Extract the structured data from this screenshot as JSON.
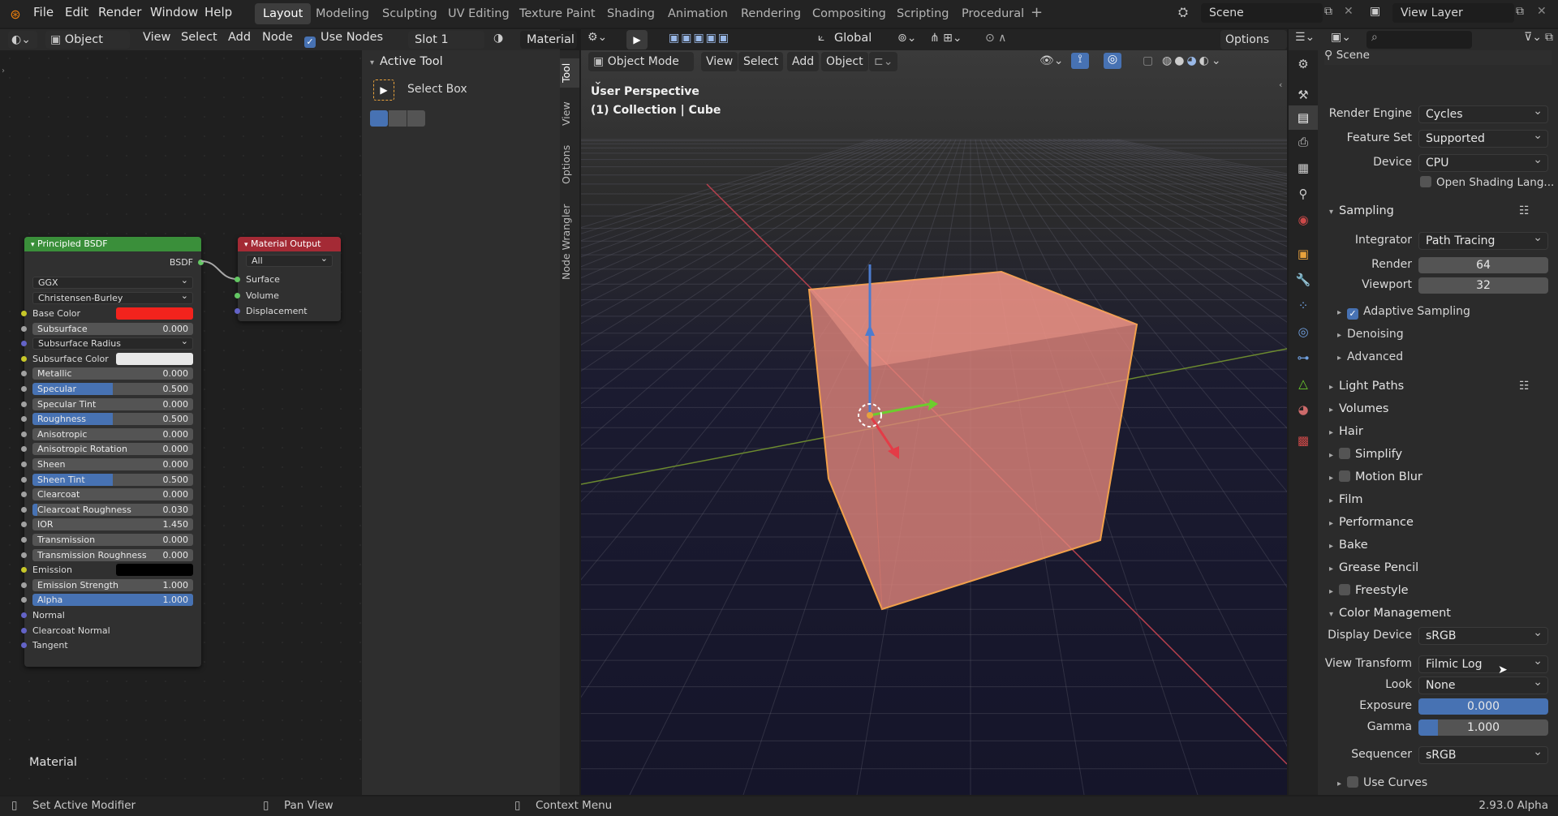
{
  "menu": {
    "file": "File",
    "edit": "Edit",
    "render": "Render",
    "window": "Window",
    "help": "Help"
  },
  "workspaces": [
    "Layout",
    "Modeling",
    "Sculpting",
    "UV Editing",
    "Texture Paint",
    "Shading",
    "Animation",
    "Rendering",
    "Compositing",
    "Scripting",
    "Procedural"
  ],
  "scene": {
    "label": "Scene",
    "view_layer": "View Layer"
  },
  "node_header": {
    "mode": "Object",
    "view": "View",
    "select": "Select",
    "add": "Add",
    "node": "Node",
    "use_nodes": "Use Nodes",
    "slot": "Slot 1",
    "material": "Material"
  },
  "principled": {
    "title": "Principled BSDF",
    "output": "BSDF",
    "distribution": "GGX",
    "subsurface_method": "Christensen-Burley",
    "inputs": [
      {
        "label": "Base Color",
        "type": "color",
        "color": "#f2231d",
        "sock": "sy"
      },
      {
        "label": "Subsurface",
        "value": "0.000",
        "fill": 0,
        "sock": "sg"
      },
      {
        "label": "Subsurface Radius",
        "type": "dd",
        "sock": "sb"
      },
      {
        "label": "Subsurface Color",
        "type": "color",
        "color": "#e8e8e8",
        "sock": "sy"
      },
      {
        "label": "Metallic",
        "value": "0.000",
        "fill": 0,
        "sock": "sg"
      },
      {
        "label": "Specular",
        "value": "0.500",
        "fill": 0.5,
        "sock": "sg"
      },
      {
        "label": "Specular Tint",
        "value": "0.000",
        "fill": 0,
        "sock": "sg"
      },
      {
        "label": "Roughness",
        "value": "0.500",
        "fill": 0.5,
        "sock": "sg"
      },
      {
        "label": "Anisotropic",
        "value": "0.000",
        "fill": 0,
        "sock": "sg"
      },
      {
        "label": "Anisotropic Rotation",
        "value": "0.000",
        "fill": 0,
        "sock": "sg"
      },
      {
        "label": "Sheen",
        "value": "0.000",
        "fill": 0,
        "sock": "sg"
      },
      {
        "label": "Sheen Tint",
        "value": "0.500",
        "fill": 0.5,
        "sock": "sg"
      },
      {
        "label": "Clearcoat",
        "value": "0.000",
        "fill": 0,
        "sock": "sg"
      },
      {
        "label": "Clearcoat Roughness",
        "value": "0.030",
        "fill": 0.03,
        "sock": "sg"
      },
      {
        "label": "IOR",
        "value": "1.450",
        "fill": 0,
        "sock": "sg"
      },
      {
        "label": "Transmission",
        "value": "0.000",
        "fill": 0,
        "sock": "sg"
      },
      {
        "label": "Transmission Roughness",
        "value": "0.000",
        "fill": 0,
        "sock": "sg"
      },
      {
        "label": "Emission",
        "type": "color",
        "color": "#000000",
        "sock": "sy"
      },
      {
        "label": "Emission Strength",
        "value": "1.000",
        "fill": 0,
        "sock": "sg"
      },
      {
        "label": "Alpha",
        "value": "1.000",
        "fill": 1,
        "sock": "sg"
      },
      {
        "label": "Normal",
        "type": "socket",
        "sock": "sb"
      },
      {
        "label": "Clearcoat Normal",
        "type": "socket",
        "sock": "sb"
      },
      {
        "label": "Tangent",
        "type": "socket",
        "sock": "sb"
      }
    ]
  },
  "matout": {
    "title": "Material Output",
    "target": "All",
    "inputs": [
      "Surface",
      "Volume",
      "Displacement"
    ]
  },
  "node_footer": "Material",
  "npanel": {
    "title": "Active Tool",
    "tool": "Select Box",
    "tabs": [
      "Tool",
      "View",
      "Options",
      "Node Wrangler"
    ]
  },
  "viewport": {
    "mode": "Object Mode",
    "view": "View",
    "select": "Select",
    "add": "Add",
    "object": "Object",
    "orientation": "Global",
    "options": "Options",
    "persp": "User Perspective",
    "collection": "(1) Collection | Cube"
  },
  "props": {
    "scene": "Scene",
    "render_engine_label": "Render Engine",
    "render_engine": "Cycles",
    "feature_set_label": "Feature Set",
    "feature_set": "Supported",
    "device_label": "Device",
    "device": "CPU",
    "osl": "Open Shading Lang...",
    "sampling": "Sampling",
    "integrator_label": "Integrator",
    "integrator": "Path Tracing",
    "render_label": "Render",
    "render_val": "64",
    "viewport_label": "Viewport",
    "viewport_val": "32",
    "adaptive": "Adaptive Sampling",
    "denoising": "Denoising",
    "advanced": "Advanced",
    "sections": [
      "Light Paths",
      "Volumes",
      "Hair",
      "Simplify",
      "Motion Blur",
      "Film",
      "Performance",
      "Bake",
      "Grease Pencil",
      "Freestyle",
      "Color Management"
    ],
    "display_device_label": "Display Device",
    "display_device": "sRGB",
    "view_transform_label": "View Transform",
    "view_transform": "Filmic Log",
    "look_label": "Look",
    "look": "None",
    "exposure_label": "Exposure",
    "exposure": "0.000",
    "gamma_label": "Gamma",
    "gamma": "1.000",
    "gamma_fill": 0.15,
    "sequencer_label": "Sequencer",
    "sequencer": "sRGB",
    "use_curves": "Use Curves"
  },
  "status": {
    "left": "Set Active Modifier",
    "middle": "Pan View",
    "right": "Context Menu",
    "version": "2.93.0 Alpha"
  }
}
